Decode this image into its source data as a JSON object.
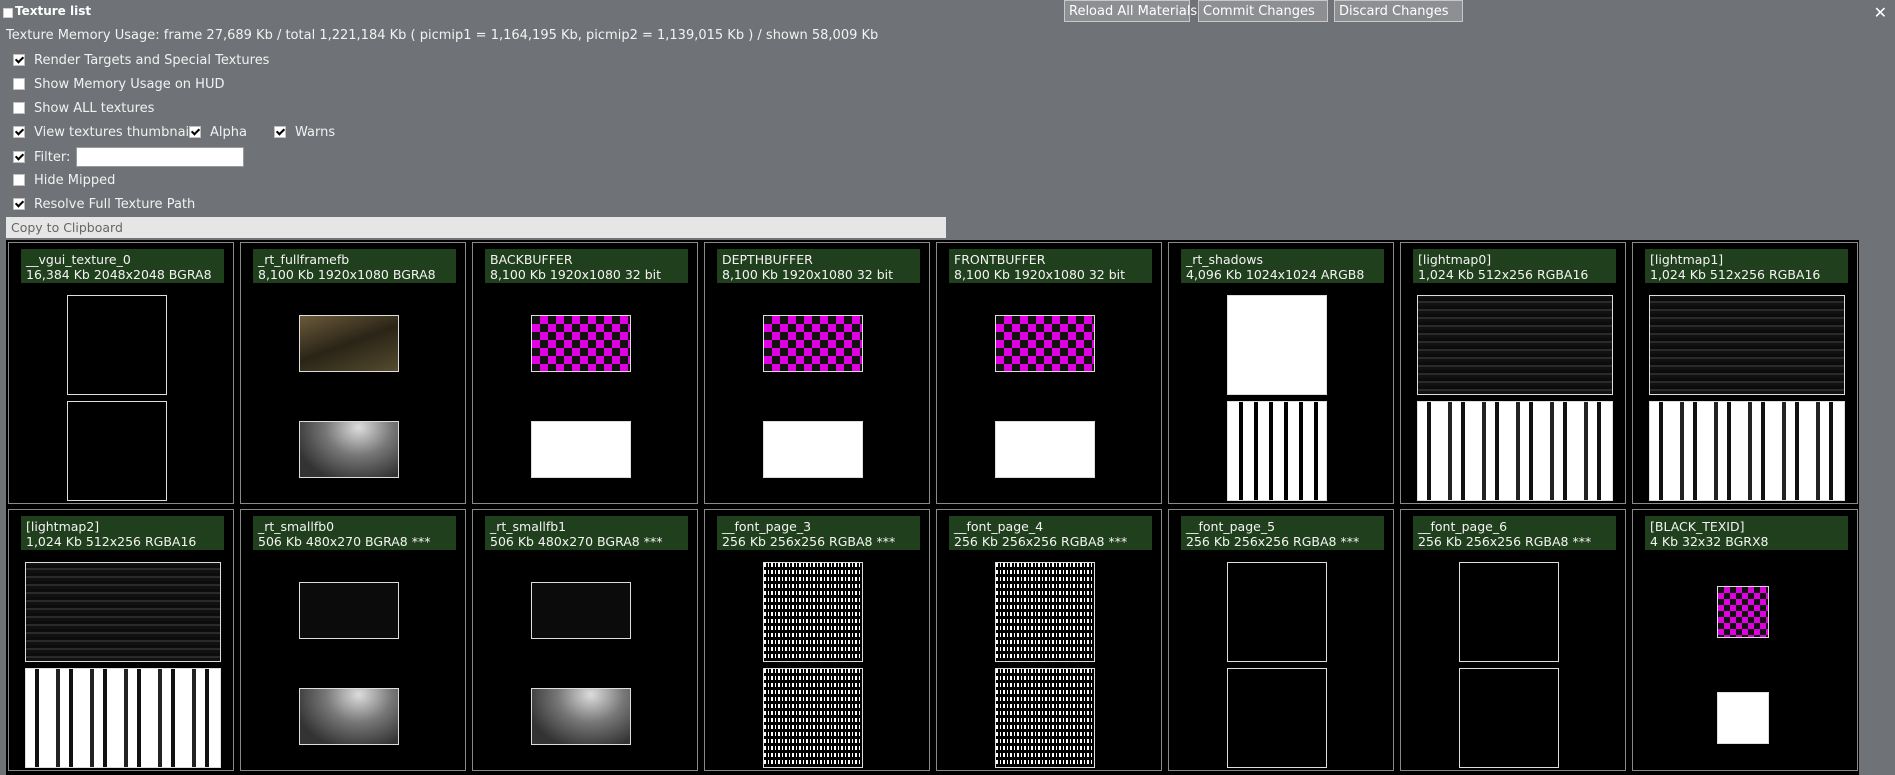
{
  "window": {
    "title": "Texture list",
    "close_glyph": "✕"
  },
  "toolbar": {
    "reload_label": "Reload All Materials",
    "commit_label": "Commit Changes",
    "discard_label": "Discard Changes"
  },
  "memory_usage": "Texture Memory Usage:  frame 27,689 Kb  /  total 1,221,184 Kb  ( picmip1 = 1,164,195 Kb, picmip2 = 1,139,015 Kb )  /  shown 58,009 Kb",
  "options": {
    "render_targets": {
      "label": "Render Targets and Special Textures",
      "checked": true
    },
    "show_memory_hud": {
      "label": "Show Memory Usage on HUD",
      "checked": false
    },
    "show_all": {
      "label": "Show ALL textures",
      "checked": false
    },
    "view_thumbnails": {
      "label": "View textures thumbnails",
      "checked": true
    },
    "alpha": {
      "label": "Alpha",
      "checked": true
    },
    "warns": {
      "label": "Warns",
      "checked": true
    },
    "filter": {
      "label": "Filter:",
      "checked": true,
      "value": "",
      "placeholder": ""
    },
    "hide_mipped": {
      "label": "Hide Mipped",
      "checked": false
    },
    "resolve_path": {
      "label": "Resolve Full Texture Path",
      "checked": true
    }
  },
  "copy_label": "Copy to Clipboard",
  "textures": [
    {
      "name": "__vgui_texture_0",
      "info": "16,384 Kb   2048x2048  BGRA8",
      "kind": "vgui"
    },
    {
      "name": "_rt_fullframefb",
      "info": "8,100 Kb   1920x1080  BGRA8",
      "kind": "scene"
    },
    {
      "name": "BACKBUFFER",
      "info": "8,100 Kb   1920x1080  32 bit",
      "kind": "checker"
    },
    {
      "name": "DEPTHBUFFER",
      "info": "8,100 Kb   1920x1080  32 bit",
      "kind": "checker"
    },
    {
      "name": "FRONTBUFFER",
      "info": "8,100 Kb   1920x1080  32 bit",
      "kind": "checker"
    },
    {
      "name": "_rt_shadows",
      "info": "4,096 Kb   1024x1024  ARGB8",
      "kind": "shadows"
    },
    {
      "name": "[lightmap0]",
      "info": "1,024 Kb   512x256  RGBA16",
      "kind": "lightmap"
    },
    {
      "name": "[lightmap1]",
      "info": "1,024 Kb   512x256  RGBA16",
      "kind": "lightmap"
    },
    {
      "name": "[lightmap2]",
      "info": "1,024 Kb   512x256  RGBA16",
      "kind": "lightmap"
    },
    {
      "name": "_rt_smallfb0",
      "info": "506 Kb   480x270  BGRA8   ***",
      "kind": "small"
    },
    {
      "name": "_rt_smallfb1",
      "info": "506 Kb   480x270  BGRA8   ***",
      "kind": "small"
    },
    {
      "name": "__font_page_3",
      "info": "256 Kb   256x256   RGBA8   ***",
      "kind": "font"
    },
    {
      "name": "__font_page_4",
      "info": "256 Kb   256x256   RGBA8   ***",
      "kind": "font"
    },
    {
      "name": "__font_page_5",
      "info": "256 Kb   256x256   RGBA8   ***",
      "kind": "font5"
    },
    {
      "name": "__font_page_6",
      "info": "256 Kb   256x256   RGBA8   ***",
      "kind": "font6"
    },
    {
      "name": "[BLACK_TEXID]",
      "info": "4 Kb   32x32   BGRX8",
      "kind": "black"
    }
  ]
}
